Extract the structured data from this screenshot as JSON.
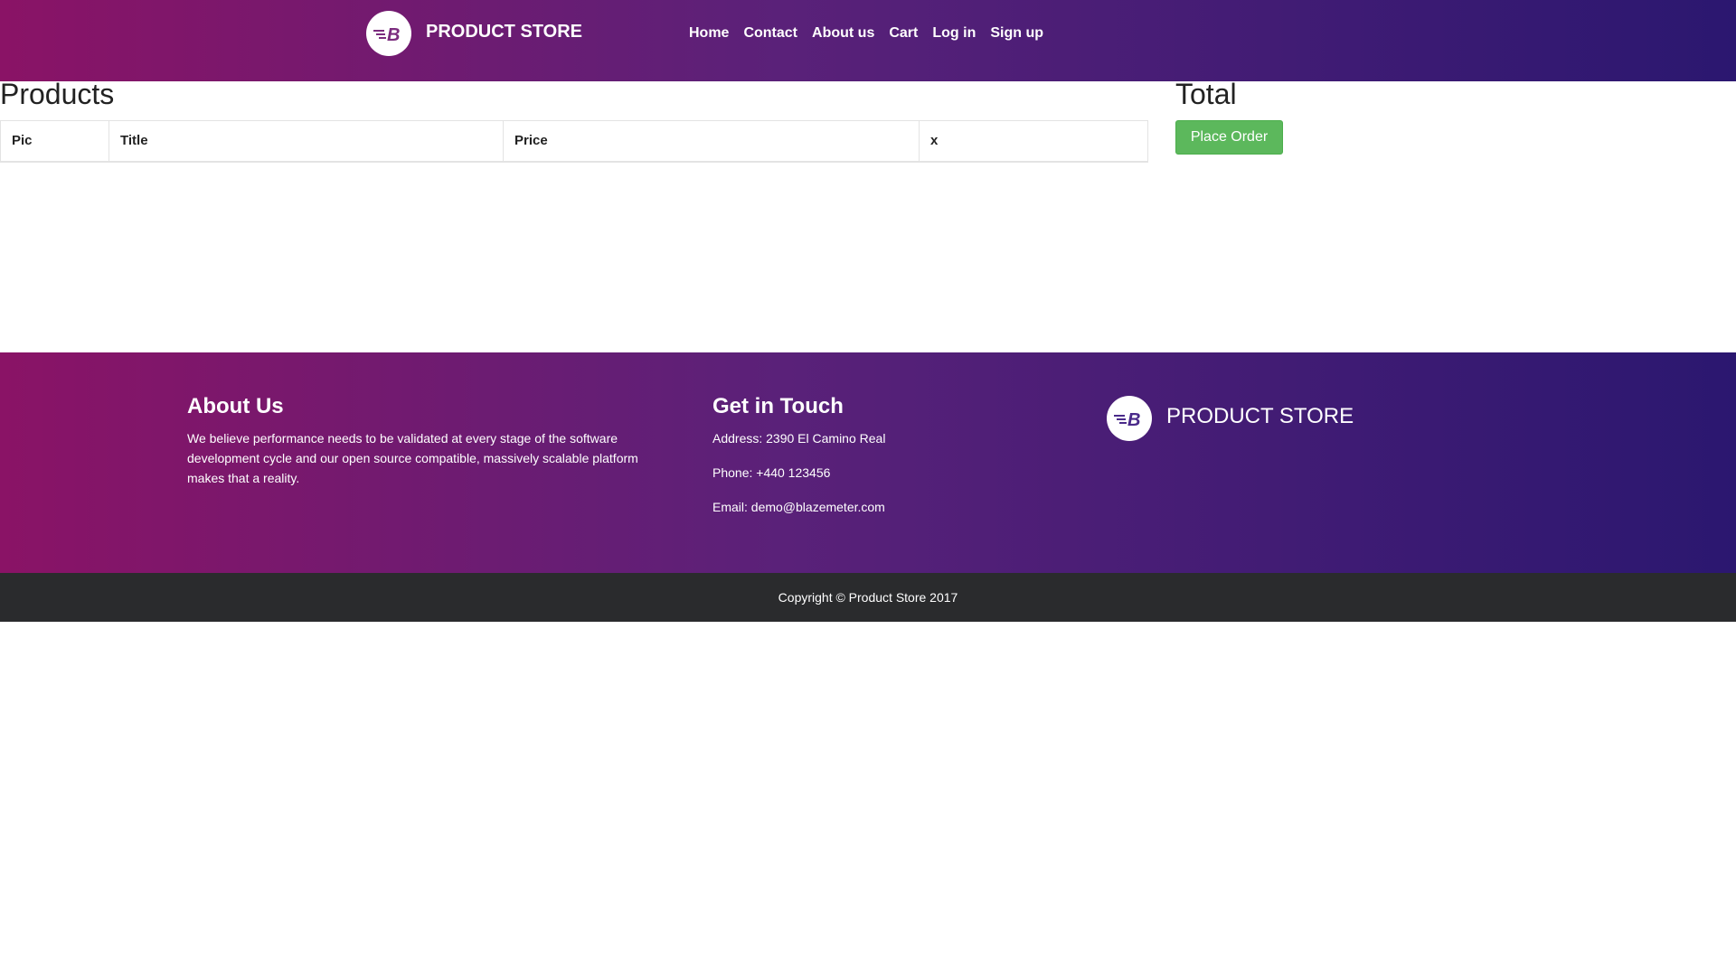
{
  "header": {
    "brand": "PRODUCT STORE",
    "logo_icon": "blazemeter-logo-icon",
    "nav": [
      {
        "label": "Home"
      },
      {
        "label": "Contact"
      },
      {
        "label": "About us"
      },
      {
        "label": "Cart"
      },
      {
        "label": "Log in"
      },
      {
        "label": "Sign up"
      }
    ]
  },
  "cart": {
    "title": "Products",
    "columns": [
      "Pic",
      "Title",
      "Price",
      "x"
    ],
    "rows": []
  },
  "summary": {
    "title": "Total",
    "place_order_label": "Place Order"
  },
  "footer": {
    "about_title": "About Us",
    "about_text": "We believe performance needs to be validated at every stage of the software development cycle and our open source compatible, massively scalable platform makes that a reality.",
    "contact_title": "Get in Touch",
    "address": "Address: 2390 El Camino Real",
    "phone": "Phone: +440 123456",
    "email": "Email: demo@blazemeter.com",
    "brand": "PRODUCT STORE"
  },
  "copyright": "Copyright © Product Store 2017",
  "colors": {
    "gradient_start": "#8a1366",
    "gradient_end": "#2b1770",
    "order_button": "#5cb85c",
    "copyright_bar": "#2a2b2d"
  }
}
